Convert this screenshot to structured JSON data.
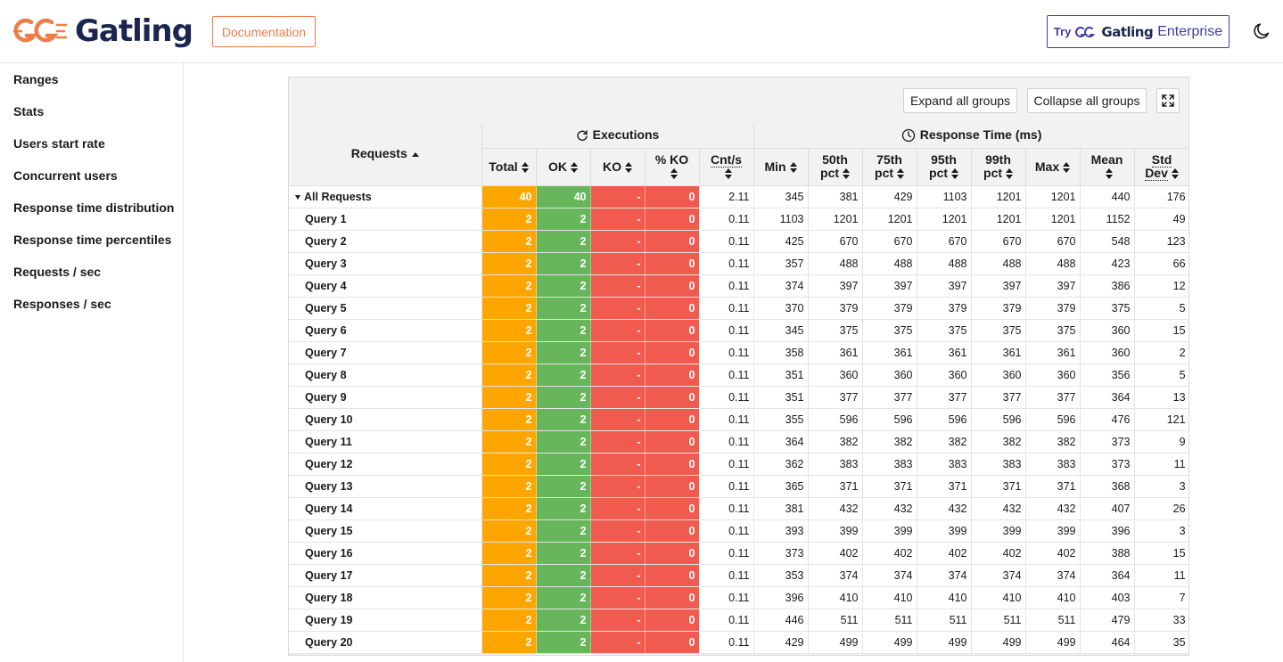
{
  "header": {
    "logo_text": "Gatling",
    "documentation_label": "Documentation",
    "enterprise": {
      "try": "Try",
      "gatling": "Gatling",
      "enterprise": "Enterprise"
    },
    "theme_icon": "moon-icon"
  },
  "sidebar": {
    "items": [
      {
        "label": "Ranges"
      },
      {
        "label": "Stats"
      },
      {
        "label": "Users start rate"
      },
      {
        "label": "Concurrent users"
      },
      {
        "label": "Response time distribution"
      },
      {
        "label": "Response time percentiles"
      },
      {
        "label": "Requests / sec"
      },
      {
        "label": "Responses / sec"
      }
    ]
  },
  "toolbar": {
    "expand_label": "Expand all groups",
    "collapse_label": "Collapse all groups",
    "fullscreen_icon": "fullscreen-icon"
  },
  "table": {
    "requests_header": "Requests",
    "executions_header": "Executions",
    "response_time_header": "Response Time (ms)",
    "columns": [
      {
        "l1": "Total",
        "l2": ""
      },
      {
        "l1": "OK",
        "l2": ""
      },
      {
        "l1": "KO",
        "l2": ""
      },
      {
        "l1": "% KO",
        "l2": ""
      },
      {
        "l1": "Cnt/s",
        "l2": ""
      },
      {
        "l1": "Min",
        "l2": ""
      },
      {
        "l1": "50th",
        "l2": "pct"
      },
      {
        "l1": "75th",
        "l2": "pct"
      },
      {
        "l1": "95th",
        "l2": "pct"
      },
      {
        "l1": "99th",
        "l2": "pct"
      },
      {
        "l1": "Max",
        "l2": ""
      },
      {
        "l1": "Mean",
        "l2": ""
      },
      {
        "l1": "Std",
        "l2": "Dev"
      }
    ],
    "rows": [
      {
        "name": "All Requests",
        "cells": [
          "40",
          "40",
          "-",
          "0",
          "2.11",
          "345",
          "381",
          "429",
          "1103",
          "1201",
          "1201",
          "440",
          "176"
        ]
      },
      {
        "name": "Query 1",
        "cells": [
          "2",
          "2",
          "-",
          "0",
          "0.11",
          "1103",
          "1201",
          "1201",
          "1201",
          "1201",
          "1201",
          "1152",
          "49"
        ]
      },
      {
        "name": "Query 2",
        "cells": [
          "2",
          "2",
          "-",
          "0",
          "0.11",
          "425",
          "670",
          "670",
          "670",
          "670",
          "670",
          "548",
          "123"
        ]
      },
      {
        "name": "Query 3",
        "cells": [
          "2",
          "2",
          "-",
          "0",
          "0.11",
          "357",
          "488",
          "488",
          "488",
          "488",
          "488",
          "423",
          "66"
        ]
      },
      {
        "name": "Query 4",
        "cells": [
          "2",
          "2",
          "-",
          "0",
          "0.11",
          "374",
          "397",
          "397",
          "397",
          "397",
          "397",
          "386",
          "12"
        ]
      },
      {
        "name": "Query 5",
        "cells": [
          "2",
          "2",
          "-",
          "0",
          "0.11",
          "370",
          "379",
          "379",
          "379",
          "379",
          "379",
          "375",
          "5"
        ]
      },
      {
        "name": "Query 6",
        "cells": [
          "2",
          "2",
          "-",
          "0",
          "0.11",
          "345",
          "375",
          "375",
          "375",
          "375",
          "375",
          "360",
          "15"
        ]
      },
      {
        "name": "Query 7",
        "cells": [
          "2",
          "2",
          "-",
          "0",
          "0.11",
          "358",
          "361",
          "361",
          "361",
          "361",
          "361",
          "360",
          "2"
        ]
      },
      {
        "name": "Query 8",
        "cells": [
          "2",
          "2",
          "-",
          "0",
          "0.11",
          "351",
          "360",
          "360",
          "360",
          "360",
          "360",
          "356",
          "5"
        ]
      },
      {
        "name": "Query 9",
        "cells": [
          "2",
          "2",
          "-",
          "0",
          "0.11",
          "351",
          "377",
          "377",
          "377",
          "377",
          "377",
          "364",
          "13"
        ]
      },
      {
        "name": "Query 10",
        "cells": [
          "2",
          "2",
          "-",
          "0",
          "0.11",
          "355",
          "596",
          "596",
          "596",
          "596",
          "596",
          "476",
          "121"
        ]
      },
      {
        "name": "Query 11",
        "cells": [
          "2",
          "2",
          "-",
          "0",
          "0.11",
          "364",
          "382",
          "382",
          "382",
          "382",
          "382",
          "373",
          "9"
        ]
      },
      {
        "name": "Query 12",
        "cells": [
          "2",
          "2",
          "-",
          "0",
          "0.11",
          "362",
          "383",
          "383",
          "383",
          "383",
          "383",
          "373",
          "11"
        ]
      },
      {
        "name": "Query 13",
        "cells": [
          "2",
          "2",
          "-",
          "0",
          "0.11",
          "365",
          "371",
          "371",
          "371",
          "371",
          "371",
          "368",
          "3"
        ]
      },
      {
        "name": "Query 14",
        "cells": [
          "2",
          "2",
          "-",
          "0",
          "0.11",
          "381",
          "432",
          "432",
          "432",
          "432",
          "432",
          "407",
          "26"
        ]
      },
      {
        "name": "Query 15",
        "cells": [
          "2",
          "2",
          "-",
          "0",
          "0.11",
          "393",
          "399",
          "399",
          "399",
          "399",
          "399",
          "396",
          "3"
        ]
      },
      {
        "name": "Query 16",
        "cells": [
          "2",
          "2",
          "-",
          "0",
          "0.11",
          "373",
          "402",
          "402",
          "402",
          "402",
          "402",
          "388",
          "15"
        ]
      },
      {
        "name": "Query 17",
        "cells": [
          "2",
          "2",
          "-",
          "0",
          "0.11",
          "353",
          "374",
          "374",
          "374",
          "374",
          "374",
          "364",
          "11"
        ]
      },
      {
        "name": "Query 18",
        "cells": [
          "2",
          "2",
          "-",
          "0",
          "0.11",
          "396",
          "410",
          "410",
          "410",
          "410",
          "410",
          "403",
          "7"
        ]
      },
      {
        "name": "Query 19",
        "cells": [
          "2",
          "2",
          "-",
          "0",
          "0.11",
          "446",
          "511",
          "511",
          "511",
          "511",
          "511",
          "479",
          "33"
        ]
      },
      {
        "name": "Query 20",
        "cells": [
          "2",
          "2",
          "-",
          "0",
          "0.11",
          "429",
          "499",
          "499",
          "499",
          "499",
          "499",
          "464",
          "35"
        ]
      }
    ]
  },
  "colors": {
    "brand_orange": "#f07c47",
    "brand_navy": "#1a2650",
    "enterprise_purple": "#3d3da8",
    "total": "#ffa500",
    "ok": "#68b65c",
    "ko": "#f15b4f"
  }
}
